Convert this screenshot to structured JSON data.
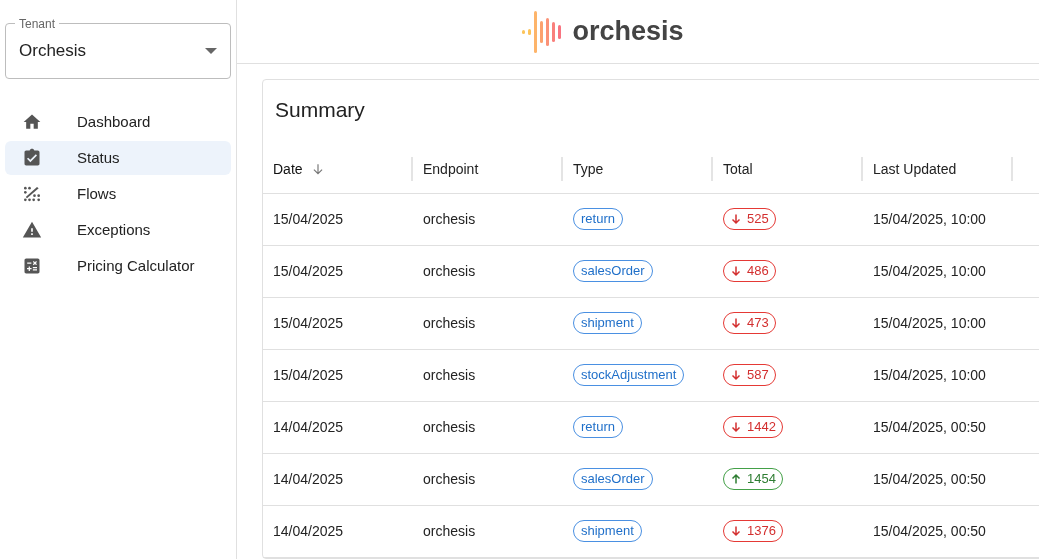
{
  "tenant": {
    "label": "Tenant",
    "value": "Orchesis"
  },
  "nav": [
    {
      "label": "Dashboard",
      "kind": "home",
      "selected": false
    },
    {
      "label": "Status",
      "kind": "clipboard",
      "selected": true
    },
    {
      "label": "Flows",
      "kind": "flows",
      "selected": false
    },
    {
      "label": "Exceptions",
      "kind": "warning",
      "selected": false
    },
    {
      "label": "Pricing Calculator",
      "kind": "calculator",
      "selected": false
    }
  ],
  "logo": {
    "text": "orchesis"
  },
  "summary": {
    "title": "Summary",
    "columns": [
      {
        "label": "Date",
        "sorted": true
      },
      {
        "label": "Endpoint",
        "sorted": false
      },
      {
        "label": "Type",
        "sorted": false
      },
      {
        "label": "Total",
        "sorted": false
      },
      {
        "label": "Last Updated",
        "sorted": false
      }
    ],
    "rows": [
      {
        "date": "15/04/2025",
        "endpoint": "orchesis",
        "type": "return",
        "total": "525",
        "kind": "down",
        "updated": "15/04/2025, 10:00"
      },
      {
        "date": "15/04/2025",
        "endpoint": "orchesis",
        "type": "salesOrder",
        "total": "486",
        "kind": "down",
        "updated": "15/04/2025, 10:00"
      },
      {
        "date": "15/04/2025",
        "endpoint": "orchesis",
        "type": "shipment",
        "total": "473",
        "kind": "down",
        "updated": "15/04/2025, 10:00"
      },
      {
        "date": "15/04/2025",
        "endpoint": "orchesis",
        "type": "stockAdjustment",
        "total": "587",
        "kind": "down",
        "updated": "15/04/2025, 10:00"
      },
      {
        "date": "14/04/2025",
        "endpoint": "orchesis",
        "type": "return",
        "total": "1442",
        "kind": "down",
        "updated": "15/04/2025, 00:50"
      },
      {
        "date": "14/04/2025",
        "endpoint": "orchesis",
        "type": "salesOrder",
        "total": "1454",
        "kind": "up",
        "updated": "15/04/2025, 00:50"
      },
      {
        "date": "14/04/2025",
        "endpoint": "orchesis",
        "type": "shipment",
        "total": "1376",
        "kind": "down",
        "updated": "15/04/2025, 00:50"
      }
    ]
  }
}
